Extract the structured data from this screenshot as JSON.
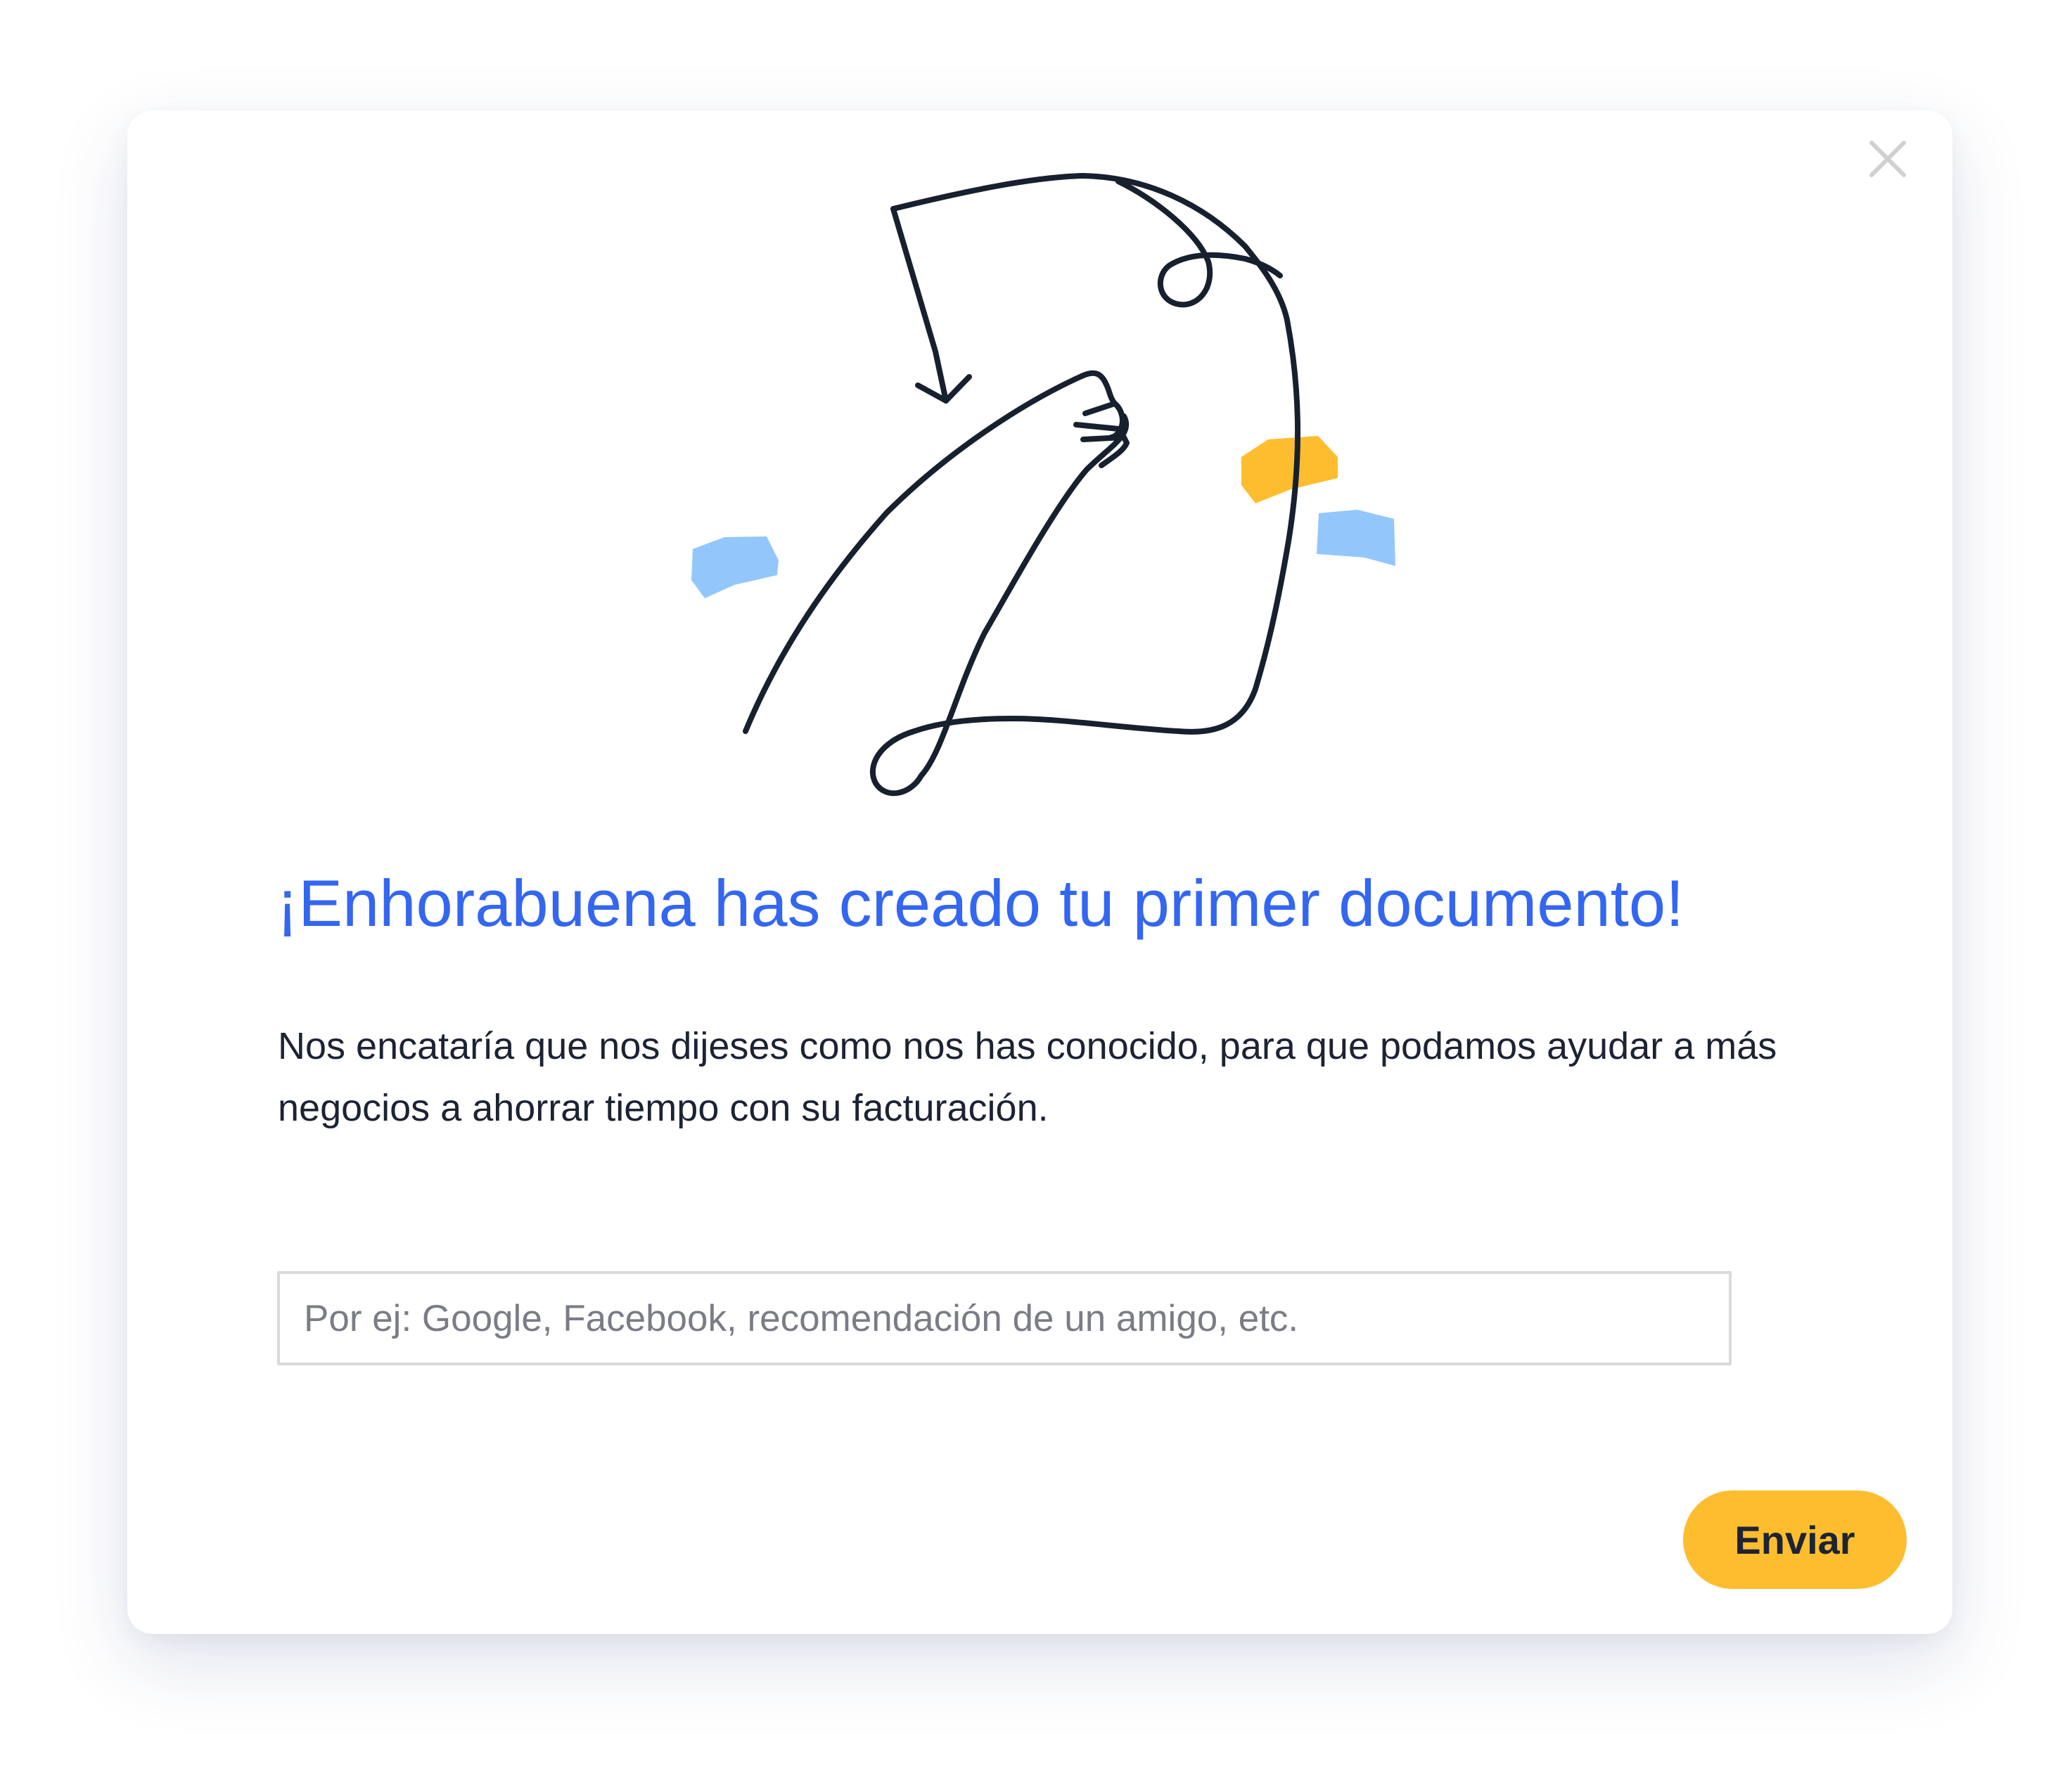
{
  "dialog": {
    "title": "¡Enhorabuena has creado tu primer documento!",
    "description": "Nos encataría que nos dijeses como nos has conocido, para que podamos ayudar a más negocios a ahorrar tiempo con su facturación.",
    "source_input": {
      "value": "",
      "placeholder": "Por ej: Google, Facebook, recomendación de un amigo, etc."
    },
    "submit_label": "Enviar",
    "close_icon": "close-icon",
    "illustration_icon": "document-sign-illustration"
  },
  "colors": {
    "title": "#3366f1",
    "button": "#fdbd2e",
    "text": "#1c2333",
    "illustration_stroke": "#17202e",
    "accent_yellow": "#fdbd2e",
    "accent_blue": "#93c7fb"
  }
}
